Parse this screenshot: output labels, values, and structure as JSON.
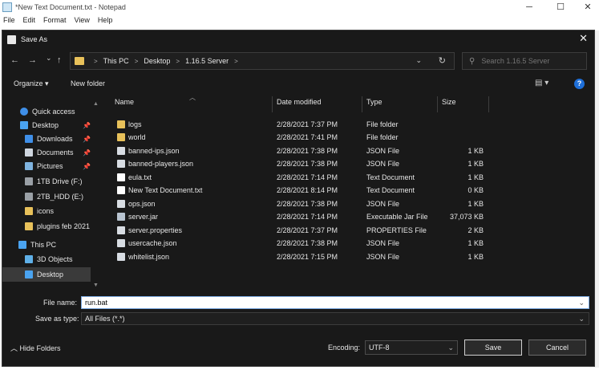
{
  "notepad": {
    "title": "*New Text Document.txt - Notepad",
    "menu": [
      "File",
      "Edit",
      "Format",
      "View",
      "Help"
    ],
    "controls": {
      "minimize": "─",
      "maximize": "☐",
      "close": "✕"
    }
  },
  "dialog": {
    "title": "Save As",
    "close": "✕",
    "nav": {
      "back": "←",
      "forward": "→",
      "recent": "⌄",
      "up": "↑"
    },
    "breadcrumb": [
      "This PC",
      "Desktop",
      "1.16.5 Server"
    ],
    "breadcrumb_sep": ">",
    "search_placeholder": "Search 1.16.5 Server",
    "toolbar": {
      "organize": "Organize ▾",
      "new_folder": "New folder",
      "help": "?"
    },
    "nav_pane": [
      {
        "label": "Quick access",
        "icon": "star-icon",
        "color": "#3f8fe8",
        "pinned": false
      },
      {
        "label": "Desktop",
        "icon": "desktop-icon",
        "color": "#4aa3f0",
        "pinned": true
      },
      {
        "label": "Downloads",
        "icon": "download-icon",
        "color": "#3f8fe8",
        "pinned": true
      },
      {
        "label": "Documents",
        "icon": "documents-icon",
        "color": "#cfd6df",
        "pinned": true
      },
      {
        "label": "Pictures",
        "icon": "pictures-icon",
        "color": "#7fb4e0",
        "pinned": true
      },
      {
        "label": "1TB Drive (F:)",
        "icon": "drive-icon",
        "color": "#9aa0a6",
        "pinned": false
      },
      {
        "label": "2TB_HDD (E:)",
        "icon": "drive-icon",
        "color": "#9aa0a6",
        "pinned": false
      },
      {
        "label": "icons",
        "icon": "folder-icon",
        "color": "#e8c15a",
        "pinned": false
      },
      {
        "label": "plugins feb 2021",
        "icon": "folder-icon",
        "color": "#e8c15a",
        "pinned": false
      },
      {
        "label": "This PC",
        "icon": "pc-icon",
        "color": "#4aa3f0",
        "pinned": false
      },
      {
        "label": "3D Objects",
        "icon": "cube-icon",
        "color": "#5fb0e8",
        "pinned": false
      },
      {
        "label": "Desktop",
        "icon": "desktop-icon",
        "color": "#4aa3f0",
        "pinned": false,
        "selected": true
      }
    ],
    "columns": [
      "Name",
      "Date modified",
      "Type",
      "Size"
    ],
    "files": [
      {
        "name": "logs",
        "date": "2/28/2021 7:37 PM",
        "type": "File folder",
        "size": "",
        "icon": "folder-icon",
        "color": "#e8c15a"
      },
      {
        "name": "world",
        "date": "2/28/2021 7:41 PM",
        "type": "File folder",
        "size": "",
        "icon": "folder-icon",
        "color": "#e8c15a"
      },
      {
        "name": "banned-ips.json",
        "date": "2/28/2021 7:38 PM",
        "type": "JSON File",
        "size": "1 KB",
        "icon": "file-icon",
        "color": "#d8dde3"
      },
      {
        "name": "banned-players.json",
        "date": "2/28/2021 7:38 PM",
        "type": "JSON File",
        "size": "1 KB",
        "icon": "file-icon",
        "color": "#d8dde3"
      },
      {
        "name": "eula.txt",
        "date": "2/28/2021 7:14 PM",
        "type": "Text Document",
        "size": "1 KB",
        "icon": "text-file-icon",
        "color": "#ffffff"
      },
      {
        "name": "New Text Document.txt",
        "date": "2/28/2021 8:14 PM",
        "type": "Text Document",
        "size": "0 KB",
        "icon": "text-file-icon",
        "color": "#ffffff"
      },
      {
        "name": "ops.json",
        "date": "2/28/2021 7:38 PM",
        "type": "JSON File",
        "size": "1 KB",
        "icon": "file-icon",
        "color": "#d8dde3"
      },
      {
        "name": "server.jar",
        "date": "2/28/2021 7:14 PM",
        "type": "Executable Jar File",
        "size": "37,073 KB",
        "icon": "jar-icon",
        "color": "#b8c4d0"
      },
      {
        "name": "server.properties",
        "date": "2/28/2021 7:37 PM",
        "type": "PROPERTIES File",
        "size": "2 KB",
        "icon": "file-icon",
        "color": "#d8dde3"
      },
      {
        "name": "usercache.json",
        "date": "2/28/2021 7:38 PM",
        "type": "JSON File",
        "size": "1 KB",
        "icon": "file-icon",
        "color": "#d8dde3"
      },
      {
        "name": "whitelist.json",
        "date": "2/28/2021 7:15 PM",
        "type": "JSON File",
        "size": "1 KB",
        "icon": "file-icon",
        "color": "#d8dde3"
      }
    ],
    "file_name_label": "File name:",
    "file_name_value": "run.bat",
    "save_type_label": "Save as type:",
    "save_type_value": "All Files  (*.*)",
    "hide_folders": "Hide Folders",
    "encoding_label": "Encoding:",
    "encoding_value": "UTF-8",
    "save_label": "Save",
    "cancel_label": "Cancel"
  }
}
